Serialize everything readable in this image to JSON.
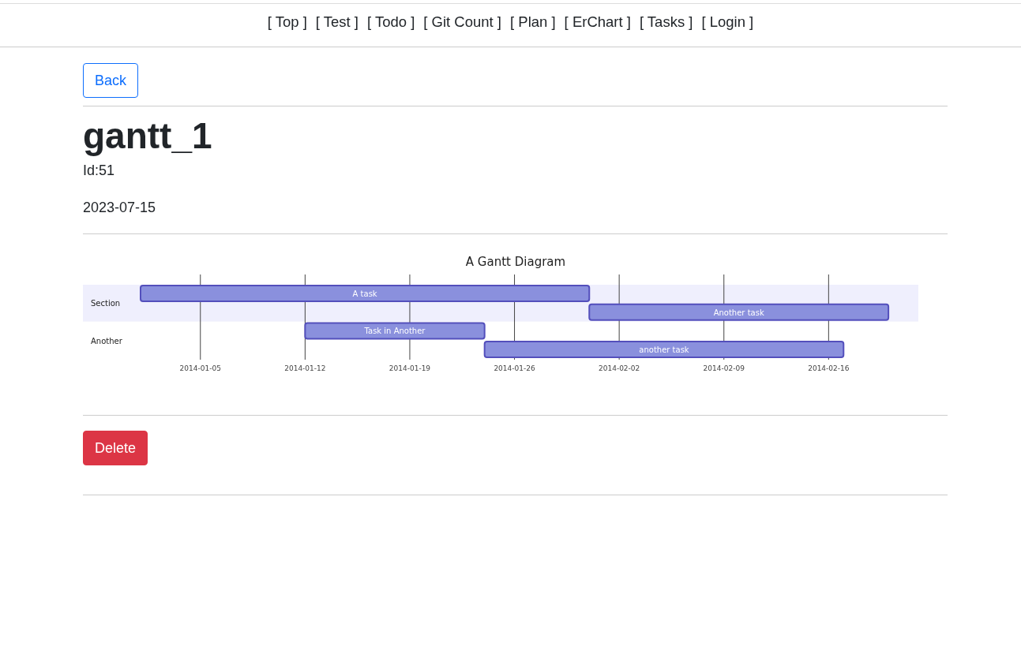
{
  "nav": {
    "links": [
      "[ Top ]",
      "[ Test ]",
      "[ Todo ]",
      "[ Git Count ]",
      "[ Plan ]",
      "[ ErChart ]",
      "[ Tasks ]",
      "[ Login ]"
    ]
  },
  "back_button": "Back",
  "title": "gantt_1",
  "id_text": "Id:51",
  "date": "2023-07-15",
  "gantt": {
    "title": "A Gantt Diagram",
    "sections": [
      {
        "label": "Section",
        "tasks": [
          {
            "label": "A task"
          },
          {
            "label": "Another task"
          }
        ]
      },
      {
        "label": "Another",
        "tasks": [
          {
            "label": "Task in Another"
          },
          {
            "label": "another task"
          }
        ]
      }
    ],
    "axis_labels": [
      "2014-01-05",
      "2014-01-12",
      "2014-01-19",
      "2014-01-26",
      "2014-02-02",
      "2014-02-09",
      "2014-02-16"
    ]
  },
  "delete_button": "Delete"
}
